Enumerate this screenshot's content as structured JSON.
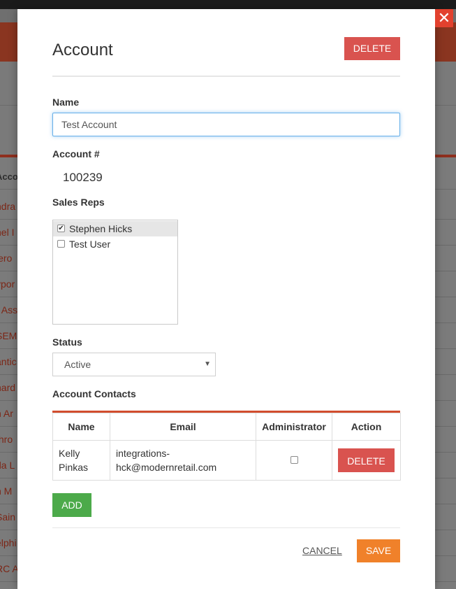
{
  "background": {
    "list_header": "Acco",
    "rows": [
      "ndra",
      "hel I",
      "lero",
      "ypor",
      "r Ass",
      "SEM",
      "antic",
      "hard",
      "n Ar",
      "thro",
      "da L",
      "n M",
      "Sain",
      "elphi",
      "RC A"
    ]
  },
  "modal": {
    "title": "Account",
    "delete_label": "DELETE",
    "name_label": "Name",
    "name_value": "Test Account",
    "account_number_label": "Account #",
    "account_number": "100239",
    "sales_reps_label": "Sales Reps",
    "sales_reps": [
      {
        "name": "Stephen Hicks",
        "checked": true
      },
      {
        "name": "Test User",
        "checked": false
      }
    ],
    "status_label": "Status",
    "status_value": "Active",
    "contacts_label": "Account Contacts",
    "contacts_table": {
      "headers": [
        "Name",
        "Email",
        "Administrator",
        "Action"
      ],
      "rows": [
        {
          "name": "Kelly Pinkas",
          "email": "integrations-hck@modernretail.com",
          "administrator": false,
          "action_label": "DELETE"
        }
      ]
    },
    "add_label": "ADD",
    "cancel_label": "CANCEL",
    "save_label": "SAVE"
  },
  "icons": {
    "close": "close-icon",
    "checkbox": "checkbox-icon",
    "dropdown": "chevron-down-icon"
  },
  "colors": {
    "delete": "#d9534f",
    "add": "#4caa4a",
    "save": "#f0812a",
    "accent_line": "#d24d2e",
    "close": "#e2412e"
  }
}
